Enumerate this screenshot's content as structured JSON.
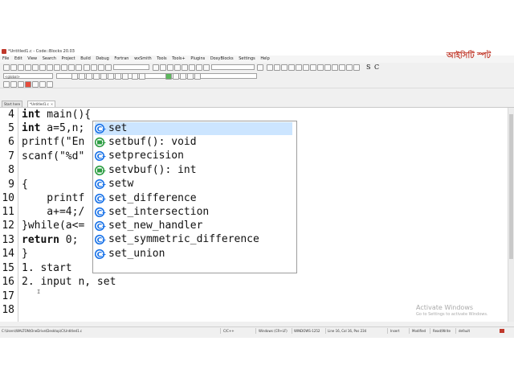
{
  "window": {
    "title": "*Untitled1.c - Code::Blocks 20.03"
  },
  "menu": {
    "items": [
      "File",
      "Edit",
      "View",
      "Search",
      "Project",
      "Build",
      "Debug",
      "Fortran",
      "wxSmith",
      "Tools",
      "Tools+",
      "Plugins",
      "DoxyBlocks",
      "Settings",
      "Help"
    ]
  },
  "toolbar": {
    "scope_combo": "<global>",
    "symbols": [
      "S",
      "C"
    ]
  },
  "tabs": [
    {
      "label": "Start here"
    },
    {
      "label": "*Untitled1.c"
    }
  ],
  "editor": {
    "lines": [
      {
        "num": "4",
        "kw": "int",
        "rest": " main(){"
      },
      {
        "num": "5",
        "kw": "int",
        "rest": " a=5,n;"
      },
      {
        "num": "6",
        "kw": "",
        "rest": "printf(\"En"
      },
      {
        "num": "7",
        "kw": "",
        "rest": "scanf(\"%d\""
      },
      {
        "num": "8",
        "kw": "",
        "rest": ""
      },
      {
        "num": "9",
        "kw": "",
        "rest": "{"
      },
      {
        "num": "10",
        "kw": "",
        "rest": "    printf"
      },
      {
        "num": "11",
        "kw": "",
        "rest": "    a+=4;/"
      },
      {
        "num": "12",
        "kw": "",
        "rest": "}while(a<="
      },
      {
        "num": "13",
        "kw": "return",
        "rest": " 0;"
      },
      {
        "num": "14",
        "kw": "",
        "rest": "}"
      },
      {
        "num": "15",
        "kw": "",
        "rest": "1. start"
      },
      {
        "num": "16",
        "kw": "",
        "rest": "2. input n, set"
      },
      {
        "num": "17",
        "kw": "",
        "rest": ""
      },
      {
        "num": "18",
        "kw": "",
        "rest": ""
      }
    ]
  },
  "autocomplete": {
    "items": [
      {
        "label": "set",
        "icon": "class-icon",
        "selected": true
      },
      {
        "label": "setbuf(): void",
        "icon": "function-icon",
        "selected": false
      },
      {
        "label": "setprecision",
        "icon": "class-icon",
        "selected": false
      },
      {
        "label": "setvbuf(): int",
        "icon": "function-icon",
        "selected": false
      },
      {
        "label": "setw",
        "icon": "class-icon",
        "selected": false
      },
      {
        "label": "set_difference",
        "icon": "class-icon",
        "selected": false
      },
      {
        "label": "set_intersection",
        "icon": "class-icon",
        "selected": false
      },
      {
        "label": "set_new_handler",
        "icon": "class-icon",
        "selected": false
      },
      {
        "label": "set_symmetric_difference",
        "icon": "class-icon",
        "selected": false
      },
      {
        "label": "set_union",
        "icon": "class-icon",
        "selected": false
      }
    ]
  },
  "status": {
    "path": "C:\\Users\\WALTON\\OneDrive\\Desktop\\C\\Untitled1.c",
    "language": "C/C++",
    "eol": "Windows (CR+LF)",
    "encoding": "WINDOWS-1252",
    "position": "Line 16, Col 16, Pos 234",
    "mode": "Insert",
    "modified": "Modified",
    "access": "Read/Write",
    "profile": "default"
  },
  "watermark": {
    "line1": "Activate Windows",
    "line2": "Go to Settings to activate Windows."
  },
  "brand": {
    "logo_text": "আইসিটি স্পট"
  },
  "colors": {
    "selection": "#cce5ff",
    "class_icon": "#1a73e8",
    "function_icon": "#2e9e44"
  }
}
